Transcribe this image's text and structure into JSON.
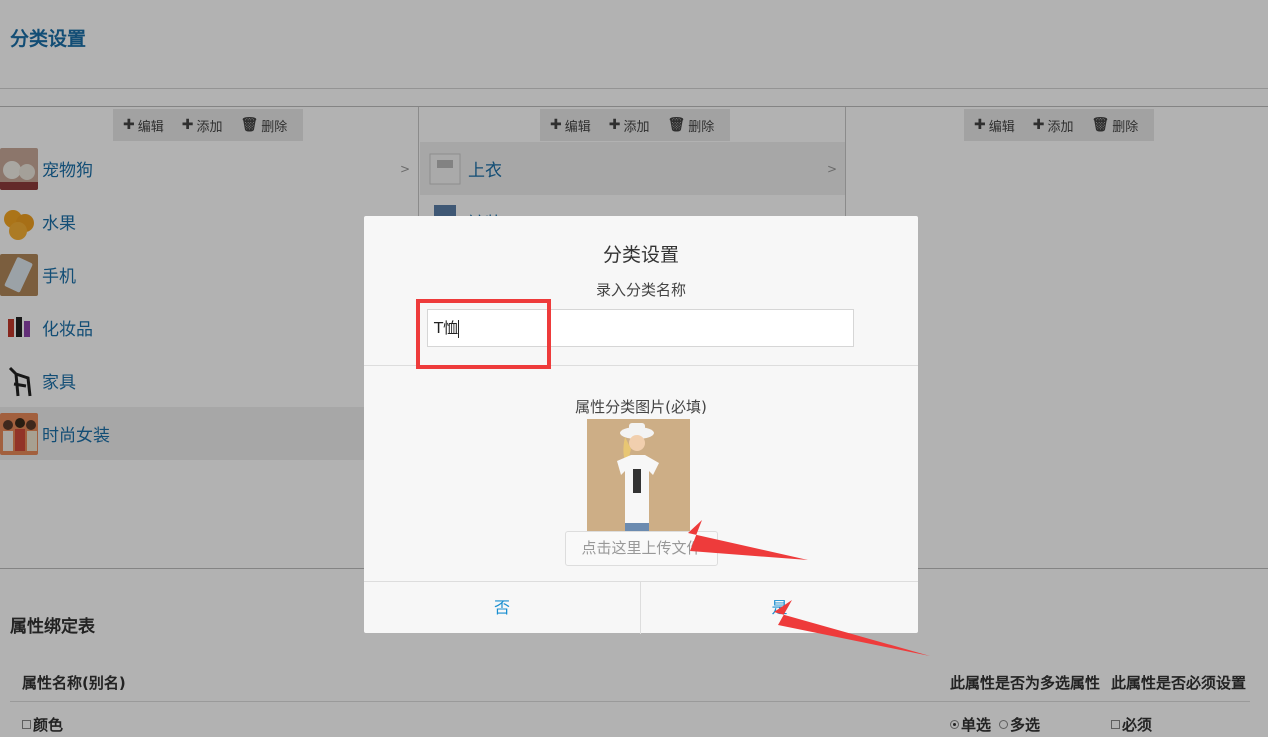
{
  "page": {
    "title": "分类设置"
  },
  "toolbar": {
    "edit": "编辑",
    "add": "添加",
    "delete": "删除"
  },
  "col1": {
    "items": [
      {
        "label": "宠物狗",
        "arrow": ">"
      },
      {
        "label": "水果"
      },
      {
        "label": "手机"
      },
      {
        "label": "化妆品"
      },
      {
        "label": "家具"
      },
      {
        "label": "时尚女装"
      }
    ]
  },
  "col2": {
    "items": [
      {
        "label": "上衣",
        "arrow": ">"
      },
      {
        "label": "裤装"
      }
    ]
  },
  "attr": {
    "section_title": "属性绑定表",
    "headers": {
      "name": "属性名称(别名)",
      "multi": "此属性是否为多选属性",
      "required": "此属性是否必须设置"
    },
    "row": {
      "name": "颜色",
      "single": "单选",
      "multi": "多选",
      "required": "必须"
    }
  },
  "modal": {
    "title": "分类设置",
    "input_label": "录入分类名称",
    "input_value": "T恤",
    "image_label": "属性分类图片(必填)",
    "upload": "点击这里上传文件",
    "no": "否",
    "yes": "是"
  },
  "colors": {
    "accent": "#1a6fa8",
    "link": "#1a8fd0",
    "annotation": "#ee3b3b"
  }
}
